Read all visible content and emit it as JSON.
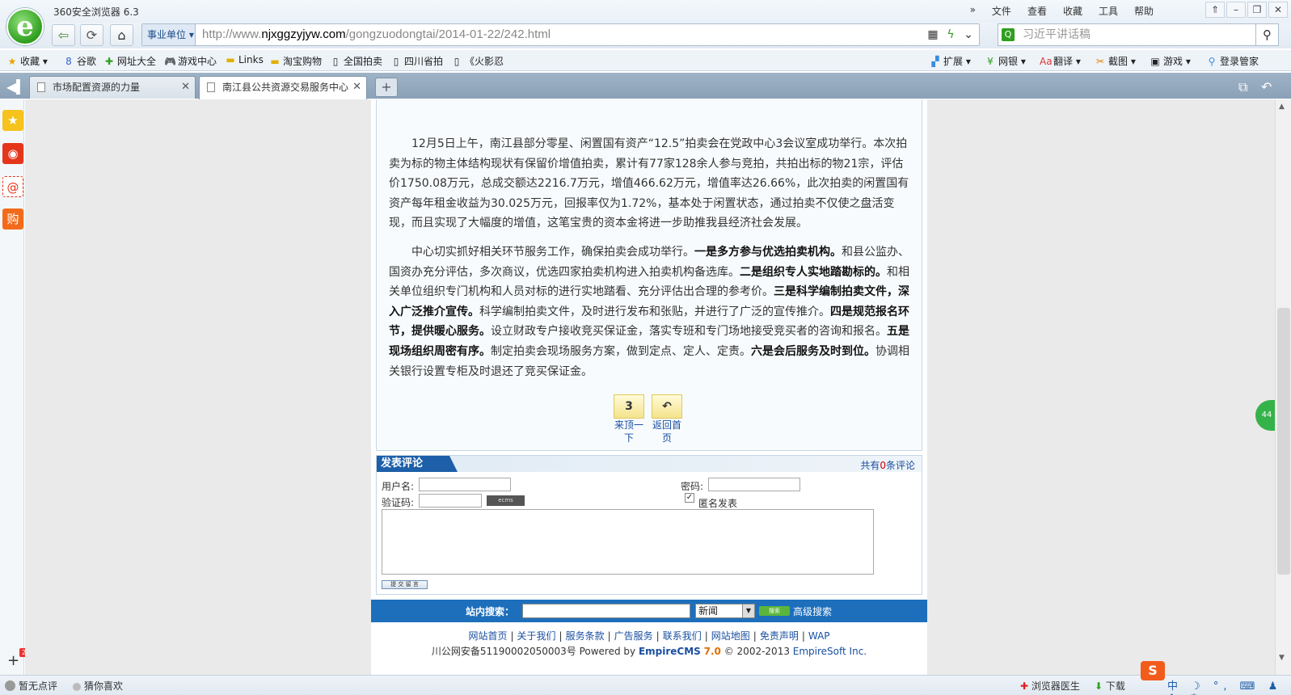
{
  "browser": {
    "title": "360安全浏览器 6.3",
    "logo_letter": "e",
    "menu": [
      "文件",
      "查看",
      "收藏",
      "工具",
      "帮助"
    ],
    "window_controls": [
      "⇑",
      "–",
      "❐",
      "✕"
    ],
    "address_tag": "事业单位",
    "url_prefix": "http://www.",
    "url_domain": "njxggzyjyw.com",
    "url_path": "/gongzuodongtai/2014-01-22/242.html",
    "search_placeholder": "习近平讲话稿"
  },
  "bookmarks": [
    "收藏",
    "谷歌",
    "网址大全",
    "游戏中心",
    "Links",
    "淘宝购物",
    "全国拍卖",
    "四川省拍",
    "《火影忍"
  ],
  "toolbar_right": [
    "扩展",
    "网银",
    "翻译",
    "截图",
    "游戏",
    "登录管家"
  ],
  "tabs": [
    {
      "label": "市场配置资源的力量"
    },
    {
      "label": "南江县公共资源交易服务中心"
    }
  ],
  "article": {
    "p1": "12月5日上午，南江县部分零星、闲置国有资产“12.5”拍卖会在党政中心3会议室成功举行。本次拍卖为标的物主体结构现状有保留价增值拍卖，累计有77家128余人参与竞拍，共拍出标的物21宗，评估价1750.08万元，总成交额达2216.7万元，增值466.62万元，增值率达26.66%，此次拍卖的闲置国有资产每年租金收益为30.025万元，回报率仅为1.72%，基本处于闲置状态，通过拍卖不仅使之盘活变现，而且实现了大幅度的增值，这笔宝贵的资本金将进一步助推我县经济社会发展。",
    "p2_a": "中心切实抓好相关环节服务工作，确保拍卖会成功举行。",
    "p2_b1": "一是多方参与优选拍卖机构。",
    "p2_c1": "和县公监办、国资办充分评估，多次商议，优选四家拍卖机构进入拍卖机构备选库。",
    "p2_b2": "二是组织专人实地踏勘标的。",
    "p2_c2": "和相关单位组织专门机构和人员对标的进行实地踏看、充分评估出合理的参考价。",
    "p2_b3": "三是科学编制拍卖文件，深入广泛推介宣传。",
    "p2_c3": "科学编制拍卖文件，及时进行发布和张贴，并进行了广泛的宣传推介。",
    "p2_b4": "四是规范报名环节，提供暖心服务。",
    "p2_c4": "设立财政专户接收竞买保证金，落实专班和专门场地接受竞买者的咨询和报名。",
    "p2_b5": "五是现场组织周密有序。",
    "p2_c5": "制定拍卖会现场服务方案，做到定点、定人、定责。",
    "p2_b6": "六是会后服务及时到位。",
    "p2_c6": "协调相关银行设置专柜及时退还了竞买保证金。",
    "btn_up_icon": "3",
    "btn_up_label": "来顶一下",
    "btn_home_icon": "↶",
    "btn_home_label": "返回首页"
  },
  "comment": {
    "title": "发表评论",
    "count_prefix": "共有",
    "count": "0",
    "count_suffix": "条评论",
    "username_label": "用户名:",
    "password_label": "密码:",
    "captcha_label": "验证码:",
    "captcha_text": "ecms",
    "anonymous_label": "匿名发表",
    "anonymous_checked": "✓",
    "submit_label": "提 交 留 言"
  },
  "site_search": {
    "label": "站内搜索：",
    "select_value": "新闻",
    "go_label": "搜索",
    "advanced_label": "高级搜索"
  },
  "footer": {
    "links": [
      "网站首页",
      "关于我们",
      "服务条款",
      "广告服务",
      "联系我们",
      "网站地图",
      "免责声明",
      "WAP"
    ],
    "icp": "川公网安备51190002050003号 Powered by ",
    "cms": "EmpireCMS",
    "version": "7.0",
    "copyright_prefix": "© 2002-2013 ",
    "company": "EmpireSoft Inc."
  },
  "status": {
    "left1": "暂无点评",
    "left2": "猜你喜欢",
    "doctor": "浏览器医生",
    "download": "下载",
    "ime": "中 ☽ °, ⌨ ♟ ⇑ ⚙",
    "badge": "2",
    "side_float": "44"
  },
  "colors": {
    "accent": "#1d6fbc",
    "brand_green": "#2f9e1f"
  }
}
